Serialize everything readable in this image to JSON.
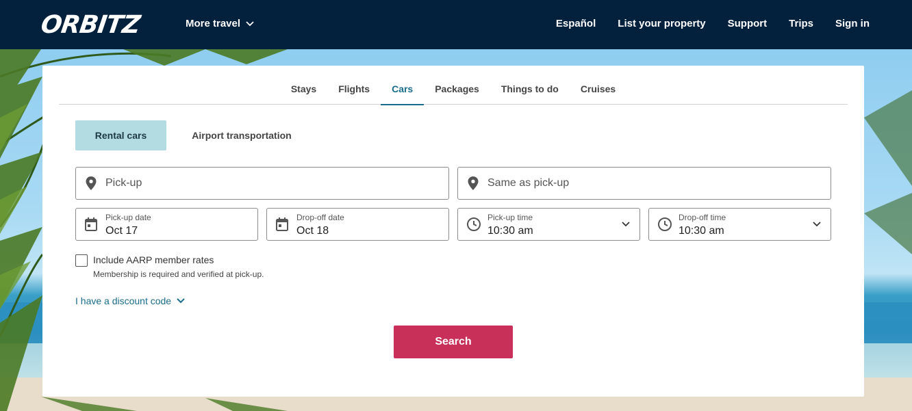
{
  "header": {
    "logo": "ORBITZ",
    "more_travel": "More travel",
    "nav": [
      "Español",
      "List your property",
      "Support",
      "Trips",
      "Sign in"
    ]
  },
  "tabs": [
    "Stays",
    "Flights",
    "Cars",
    "Packages",
    "Things to do",
    "Cruises"
  ],
  "active_tab": "Cars",
  "subtabs": {
    "rental": "Rental cars",
    "airport": "Airport transportation"
  },
  "form": {
    "pickup_placeholder": "Pick-up",
    "dropoff_placeholder": "Same as pick-up",
    "pickup_date_label": "Pick-up date",
    "pickup_date_value": "Oct 17",
    "dropoff_date_label": "Drop-off date",
    "dropoff_date_value": "Oct 18",
    "pickup_time_label": "Pick-up time",
    "pickup_time_value": "10:30 am",
    "dropoff_time_label": "Drop-off time",
    "dropoff_time_value": "10:30 am",
    "aarp_label": "Include AARP member rates",
    "aarp_sub": "Membership is required and verified at pick-up.",
    "aarp_checked": false,
    "discount_link": "I have a discount code",
    "search_label": "Search"
  },
  "colors": {
    "header_bg": "#03203d",
    "accent": "#1a6c8a",
    "search_button": "#c8305a",
    "active_subtab": "#b3dbe2"
  }
}
